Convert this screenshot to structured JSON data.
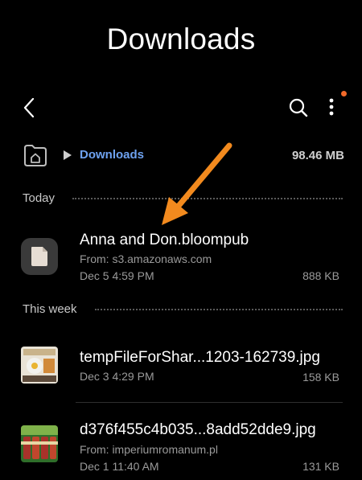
{
  "header": {
    "title": "Downloads"
  },
  "breadcrumb": {
    "label": "Downloads",
    "storage": "98.46 MB"
  },
  "sections": {
    "today": {
      "label": "Today",
      "items": [
        {
          "name": "Anna and Don.bloompub",
          "from": "From: s3.amazonaws.com",
          "date": "Dec 5 4:59 PM",
          "size": "888 KB"
        }
      ]
    },
    "this_week": {
      "label": "This week",
      "items": [
        {
          "name": "tempFileForShar...1203-162739.jpg",
          "date": "Dec 3 4:29 PM",
          "size": "158 KB"
        },
        {
          "name": "d376f455c4b035...8add52dde9.jpg",
          "from": "From: imperiumromanum.pl",
          "date": "Dec 1 11:40 AM",
          "size": "131 KB"
        }
      ]
    }
  },
  "colors": {
    "accent": "#6ea2f0",
    "arrow": "#f28a1e",
    "notify": "#f26a2a",
    "background": "#000000"
  },
  "icons": [
    "back-icon",
    "search-icon",
    "more-options-icon",
    "home-folder-icon",
    "play-triangle-icon",
    "document-icon"
  ]
}
